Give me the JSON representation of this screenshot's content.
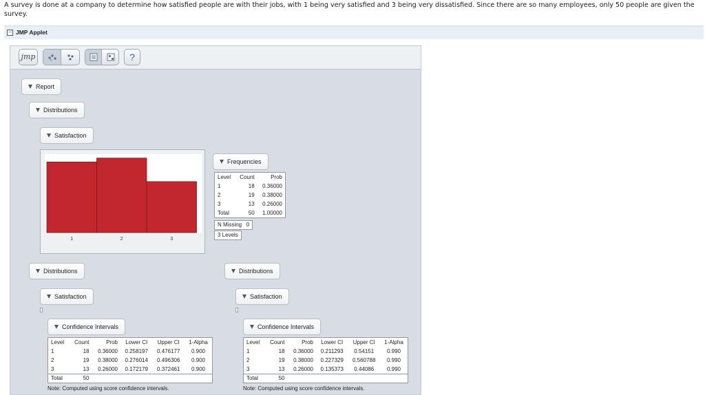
{
  "question": "A survey is done at a company to determine how satisfied people are with their jobs, with 1 being very satisfied and 3 being very dissatisfied. Since there are so many employees, only 50 people are given the survey.",
  "applet": {
    "title": "JMP Applet",
    "toggle": "−"
  },
  "toolbar": {
    "logo": "jmp",
    "help": "?"
  },
  "outline": {
    "report": "Report",
    "distributions": "Distributions",
    "satisfaction": "Satisfaction",
    "frequencies": "Frequencies",
    "confidence_intervals": "Confidence Intervals"
  },
  "chart_data": {
    "type": "bar",
    "categories": [
      "1",
      "2",
      "3"
    ],
    "values": [
      18,
      19,
      13
    ],
    "ylim": [
      0,
      20
    ]
  },
  "frequencies": {
    "headers": [
      "Level",
      "Count",
      "Prob"
    ],
    "rows": [
      [
        "1",
        "18",
        "0.36000"
      ],
      [
        "2",
        "19",
        "0.38000"
      ],
      [
        "3",
        "13",
        "0.26000"
      ],
      [
        "Total",
        "50",
        "1.00000"
      ]
    ],
    "n_missing_label": "N Missing",
    "n_missing_value": "0",
    "levels": "3  Levels"
  },
  "ci_left": {
    "headers": [
      "Level",
      "Count",
      "Prob",
      "Lower CI",
      "Upper CI",
      "1-Alpha"
    ],
    "rows": [
      [
        "1",
        "18",
        "0.36000",
        "0.258197",
        "0.476177",
        "0.900"
      ],
      [
        "2",
        "19",
        "0.38000",
        "0.276014",
        "0.496306",
        "0.900"
      ],
      [
        "3",
        "13",
        "0.26000",
        "0.172179",
        "0.372461",
        "0.900"
      ]
    ],
    "total_label": "Total",
    "total_count": "50",
    "note": "Note: Computed using score confidence intervals."
  },
  "ci_right": {
    "headers": [
      "Level",
      "Count",
      "Prob",
      "Lower CI",
      "Upper CI",
      "1-Alpha"
    ],
    "rows": [
      [
        "1",
        "18",
        "0.36000",
        "0.211293",
        "0.54151",
        "0.990"
      ],
      [
        "2",
        "19",
        "0.38000",
        "0.227329",
        "0.560788",
        "0.990"
      ],
      [
        "3",
        "13",
        "0.26000",
        "0.135373",
        "0.44086",
        "0.990"
      ]
    ],
    "total_label": "Total",
    "total_count": "50",
    "note": "Note: Computed using score confidence intervals."
  },
  "colors": {
    "bar": "#c1272d",
    "bar_edge": "#7a1a1e"
  }
}
